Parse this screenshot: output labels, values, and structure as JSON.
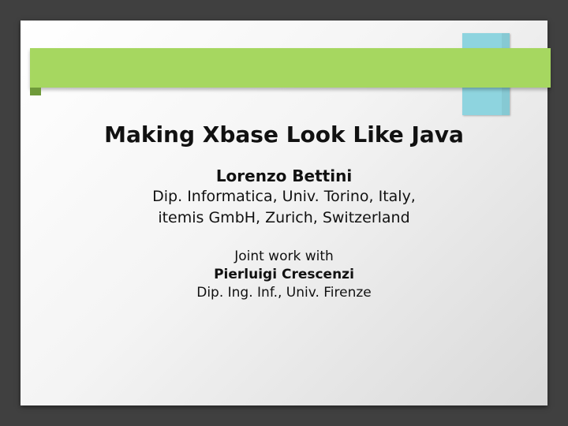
{
  "colors": {
    "frame": "#404040",
    "banner": "#a6d760",
    "ribbon": "#8ed4df"
  },
  "slide": {
    "title": "Making Xbase Look Like Java",
    "author": "Lorenzo Bettini",
    "affiliation_line1": "Dip. Informatica, Univ. Torino, Italy,",
    "affiliation_line2": "itemis GmbH, Zurich, Switzerland",
    "joint_label": "Joint work with",
    "coauthor": "Pierluigi Crescenzi",
    "coauthor_affiliation": "Dip. Ing. Inf., Univ. Firenze"
  }
}
